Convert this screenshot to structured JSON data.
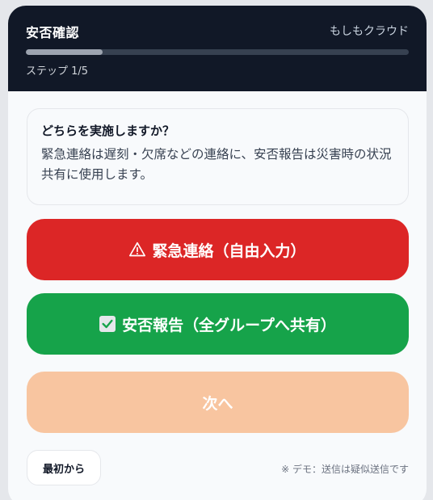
{
  "header": {
    "title": "安否確認",
    "brand": "もしもクラウド",
    "progress": 0.2,
    "step_label": "ステップ 1/5"
  },
  "question": {
    "title": "どちらを実施しますか？",
    "description": "緊急連絡は遅刻・欠席などの連絡に、安否報告は災害時の状況共有に使用します。"
  },
  "buttons": {
    "emergency_label": "緊急連絡（自由入力）",
    "safety_label": "安否報告（全グループへ共有）",
    "next_label": "次へ",
    "restart_label": "最初から"
  },
  "footer": {
    "demo_note": "※ デモ：送信は疑似送信です"
  },
  "colors": {
    "header_bg": "#111827",
    "emergency": "#dc2626",
    "safety": "#16a34a",
    "next_disabled": "#f8c5a0"
  },
  "icons": {
    "emergency": "warning-icon",
    "safety": "check-box-icon"
  }
}
